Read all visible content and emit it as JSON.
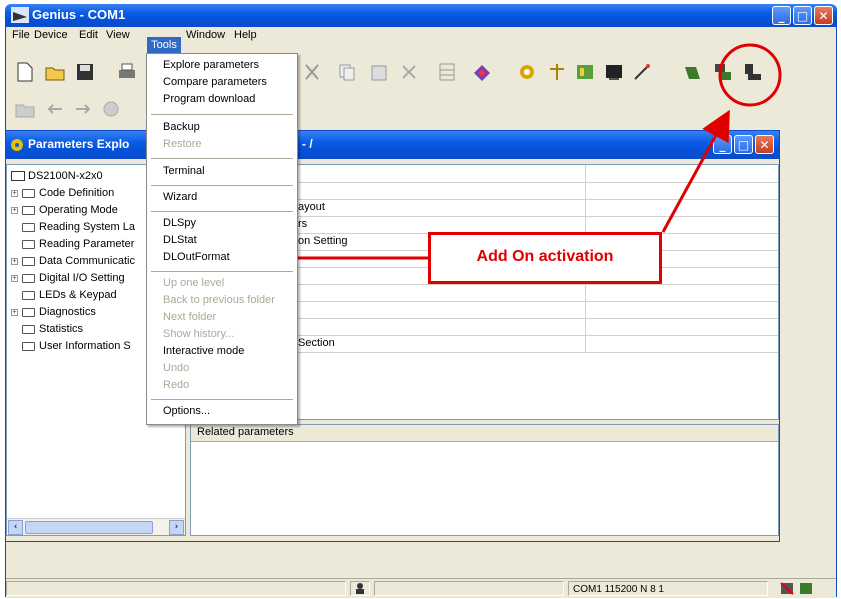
{
  "window": {
    "title": "Genius - COM1"
  },
  "menubar": {
    "items": [
      "File",
      "Device",
      "Edit",
      "View",
      "Tools",
      "Window",
      "Help"
    ]
  },
  "tools_menu": {
    "groups": [
      {
        "items": [
          {
            "label": "Explore parameters",
            "enabled": true
          },
          {
            "label": "Compare parameters",
            "enabled": true
          },
          {
            "label": "Program download",
            "enabled": true
          }
        ]
      },
      {
        "items": [
          {
            "label": "Backup",
            "enabled": true
          },
          {
            "label": "Restore",
            "enabled": false
          }
        ]
      },
      {
        "items": [
          {
            "label": "Terminal",
            "enabled": true
          }
        ]
      },
      {
        "items": [
          {
            "label": "Wizard",
            "enabled": true
          }
        ]
      },
      {
        "items": [
          {
            "label": "DLSpy",
            "enabled": true
          },
          {
            "label": "DLStat",
            "enabled": true
          },
          {
            "label": "DLOutFormat",
            "enabled": true
          }
        ]
      },
      {
        "items": [
          {
            "label": "Up one level",
            "enabled": false
          },
          {
            "label": "Back to previous folder",
            "enabled": false
          },
          {
            "label": "Next folder",
            "enabled": false
          },
          {
            "label": "Show history...",
            "enabled": false
          },
          {
            "label": "Interactive mode",
            "enabled": true
          },
          {
            "label": "Undo",
            "enabled": false
          },
          {
            "label": "Redo",
            "enabled": false
          }
        ]
      },
      {
        "items": [
          {
            "label": "Options...",
            "enabled": true
          }
        ]
      }
    ]
  },
  "child_window": {
    "title_left": "Parameters Explo",
    "title_right": "- /"
  },
  "tree": {
    "root": "DS2100N-x2x0",
    "items": [
      {
        "label": "Code Definition",
        "expandable": true
      },
      {
        "label": "Operating Mode",
        "expandable": true
      },
      {
        "label": "Reading System La",
        "expandable": false
      },
      {
        "label": "Reading Parameter",
        "expandable": false
      },
      {
        "label": "Data Communicatic",
        "expandable": true
      },
      {
        "label": "Digital I/O Setting",
        "expandable": true
      },
      {
        "label": "LEDs & Keypad",
        "expandable": false
      },
      {
        "label": "Diagnostics",
        "expandable": true
      },
      {
        "label": "Statistics",
        "expandable": false
      },
      {
        "label": "User Information S",
        "expandable": false
      }
    ]
  },
  "grid": {
    "rows": [
      "",
      "",
      "ayout",
      "rs",
      "on Setting",
      "",
      "",
      "",
      "",
      "",
      "Section",
      ""
    ]
  },
  "related": {
    "header": "Related parameters"
  },
  "status": {
    "port": "COM1 115200 N 8 1"
  },
  "annotation": {
    "text": "Add On activation",
    "color": "#e00000"
  }
}
